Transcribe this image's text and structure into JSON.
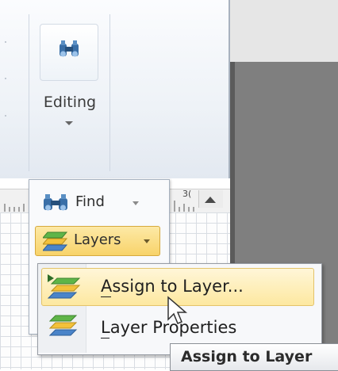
{
  "ribbon": {
    "editing_group": {
      "label": "Editing",
      "icon": "binoculars-icon"
    }
  },
  "ruler": {
    "number": "3("
  },
  "edit_panel": {
    "find": {
      "label": "Find",
      "icon": "binoculars-icon"
    },
    "layers": {
      "label": "Layers",
      "icon": "layers-icon",
      "state": "pressed"
    }
  },
  "menu": {
    "items": [
      {
        "label": "Assign to Layer...",
        "accelerator": "A",
        "icon": "assign-layer-icon",
        "state": "hover"
      },
      {
        "label": "Layer Properties",
        "accelerator": "L",
        "icon": "layer-properties-icon"
      }
    ]
  },
  "tooltip": {
    "title": "Assign to Layer"
  },
  "colors": {
    "highlight": "#fde8a0",
    "highlight_border": "#e3c36a",
    "canvas_gray": "#7f7f7f",
    "layer_green": "#5fb548",
    "layer_blue": "#4a84c9",
    "layer_yellow": "#f3c13a"
  }
}
